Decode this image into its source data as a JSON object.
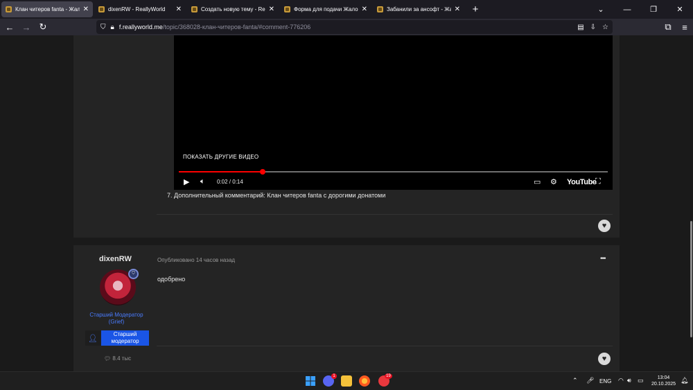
{
  "browser": {
    "tabs": [
      {
        "title": "Клан читеров fanta - Жалобы",
        "active": true
      },
      {
        "title": "dixenRW - ReallyWorld",
        "active": false
      },
      {
        "title": "Создать новую тему - ReallyW",
        "active": false
      },
      {
        "title": "Форма для подачи Жалобы н",
        "active": false
      },
      {
        "title": "Забанили за ансофт - Жалобы",
        "active": false
      }
    ],
    "url_domain": "f.reallyworld.me",
    "url_path": "/topic/368028-клан-читеров-fanta/#comment-776206"
  },
  "video": {
    "more_videos": "ПОКАЗАТЬ ДРУГИЕ ВИДЕО",
    "time": "0:02 / 0:14",
    "progress": 0.195,
    "brand": "YouTube"
  },
  "post1": {
    "item7": "7. Дополнительный комментарий: Клан читеров fanta с дорогими донатоми"
  },
  "post2": {
    "author": "dixenRW",
    "published": "Опубликовано 14 часов назад",
    "comment": "одобрено",
    "role_line1": "Старший Модератор",
    "role_line2": "(Grief)",
    "group_line1": "Старший",
    "group_line2": "модератор",
    "reputation": "8.4 тыс"
  },
  "taskbar": {
    "discord_badge": "1",
    "telegram_badge": "19",
    "language": "ENG",
    "time": "13:04",
    "date": "20.10.2025"
  }
}
